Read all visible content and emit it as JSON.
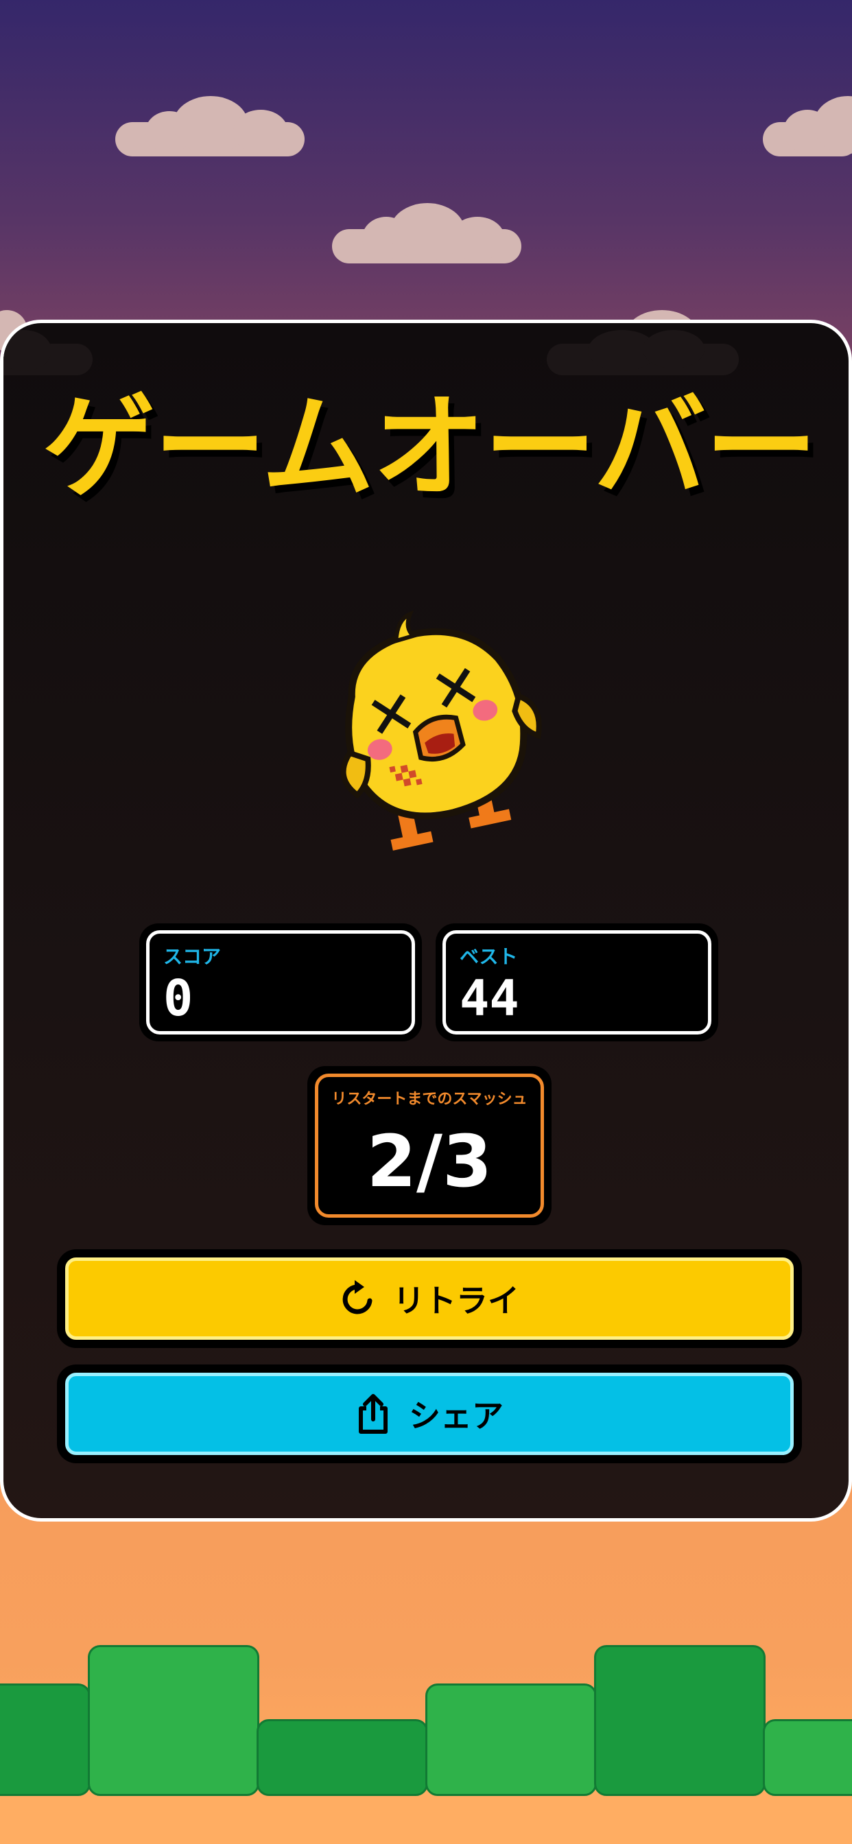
{
  "title": "ゲームオーバー",
  "character": "dazed-chick",
  "stats": {
    "score": {
      "label": "スコア",
      "value": "0"
    },
    "best": {
      "label": "ベスト",
      "value": "44"
    }
  },
  "restart": {
    "label": "リスタートまでのスマッシュ",
    "value": "2/3"
  },
  "buttons": {
    "retry": {
      "label": "リトライ",
      "icon": "refresh-icon"
    },
    "share": {
      "label": "シェア",
      "icon": "share-icon"
    }
  },
  "colors": {
    "title": "#fbcd12",
    "stat_label": "#1fb6e8",
    "restart_accent": "#f28a2c",
    "retry_button": "#fcca00",
    "share_button": "#04c0e6"
  }
}
